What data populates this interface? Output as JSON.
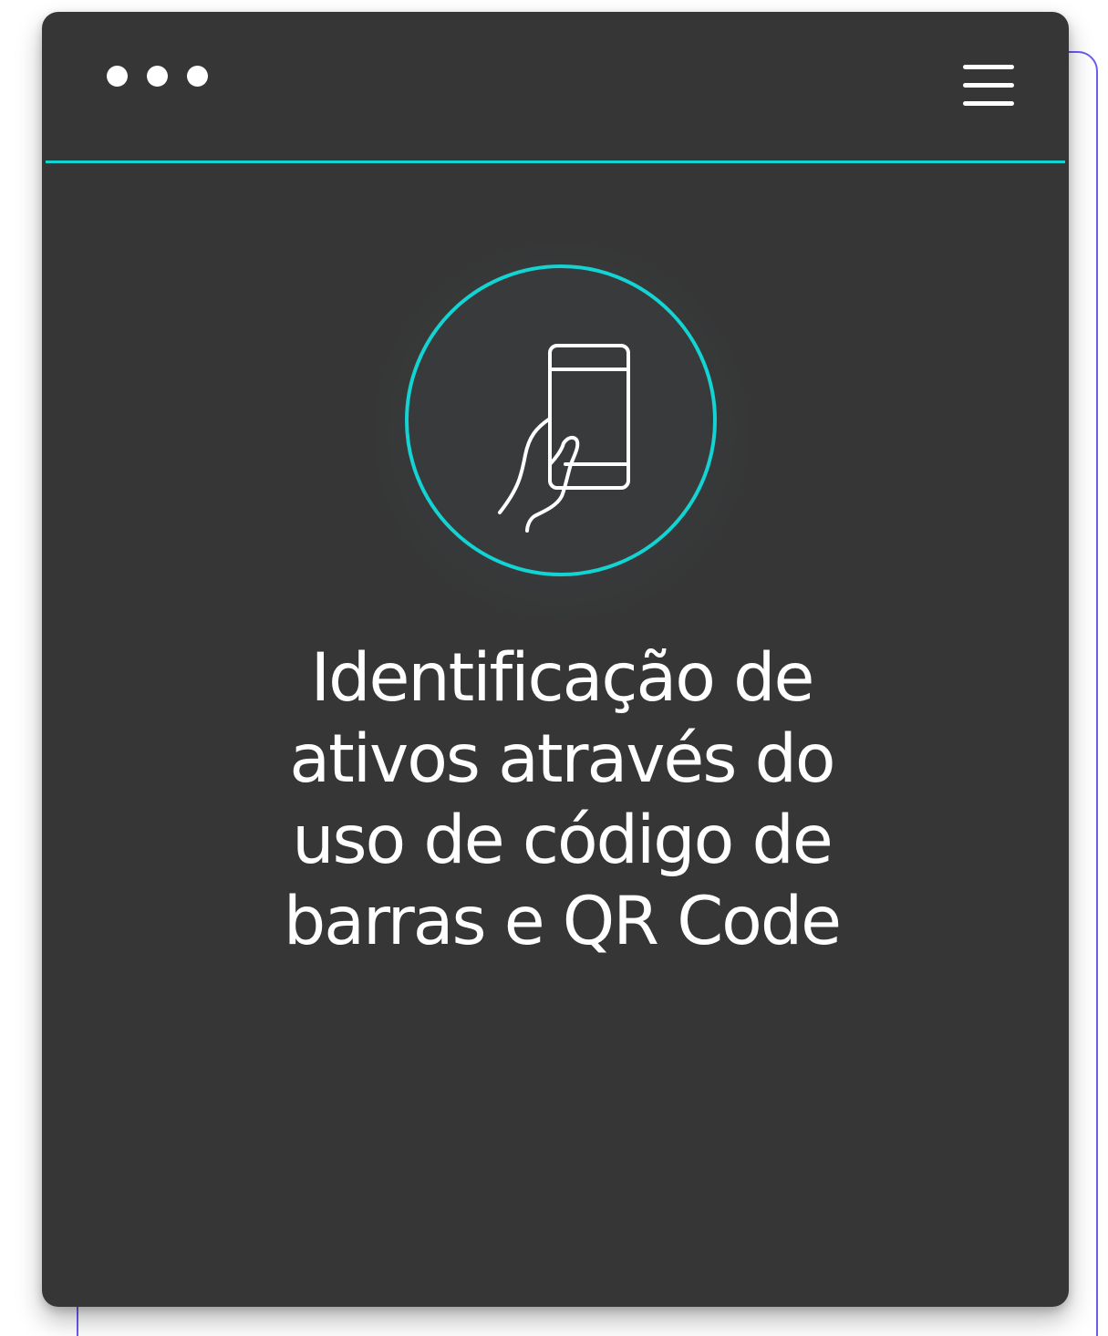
{
  "window": {
    "dots_icon": "window-dots-icon",
    "menu_icon": "hamburger-menu-icon"
  },
  "feature": {
    "icon": "hand-holding-phone-icon",
    "title_lines": [
      "Identificação de",
      "ativos através do",
      "uso de código de",
      "barras e QR Code"
    ]
  },
  "colors": {
    "card_background": "#363636",
    "accent": "#13d3d3",
    "frame_outline": "#6b5cf0",
    "text": "#ffffff"
  }
}
